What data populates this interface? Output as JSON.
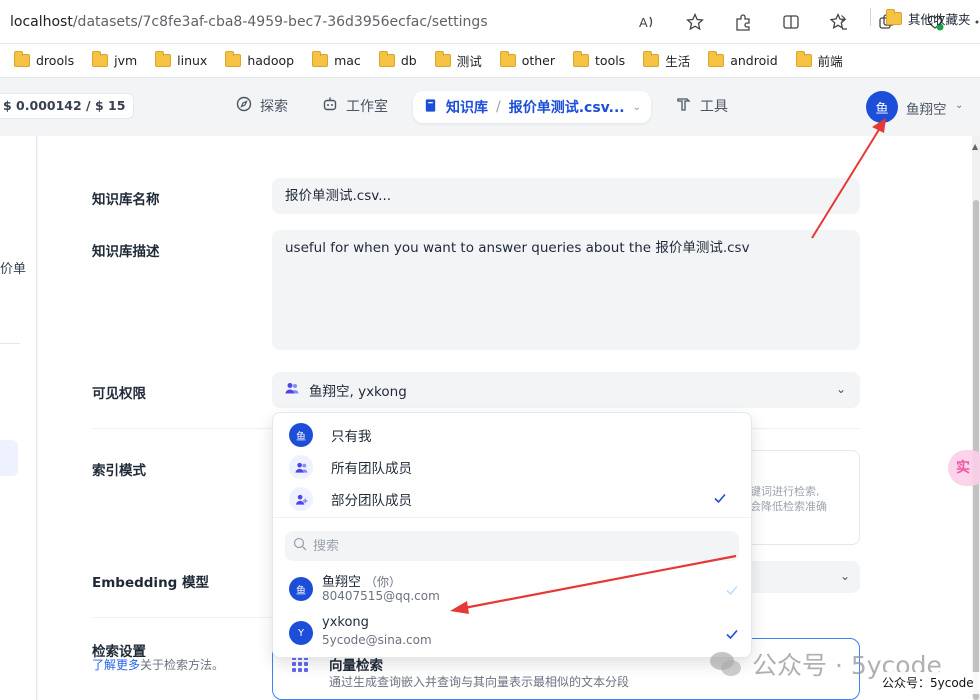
{
  "browser": {
    "url_host": "localhost",
    "url_path": "/datasets/7c8fe3af-cba8-4959-bec7-36d3956ecfac/settings",
    "icons": [
      "read-aloud-icon",
      "favorite-star-icon",
      "extensions-icon",
      "split-screen-icon",
      "favorites-icon",
      "collections-icon",
      "performance-icon",
      "more-icon"
    ],
    "notification_count": "1"
  },
  "bookmarks": {
    "items": [
      "drools",
      "jvm",
      "linux",
      "hadoop",
      "mac",
      "db",
      "测试",
      "other",
      "tools",
      "生活",
      "android",
      "前端"
    ],
    "more": "›",
    "other_favorites": "其他收藏夹"
  },
  "nav": {
    "cost": "$ 0.000142 / $ 15",
    "explore": "探索",
    "studio": "工作室",
    "knowledge": "知识库",
    "crumb_sep": "/",
    "dataset_name": "报价单测试.csv...",
    "tools": "工具",
    "avatar_char": "鱼",
    "username": "鱼翔空"
  },
  "sidebar": {
    "partial_text": "价单"
  },
  "form": {
    "name_label": "知识库名称",
    "name_value": "报价单测试.csv...",
    "desc_label": "知识库描述",
    "desc_value": "useful for when you want to answer queries about the 报价单测试.csv",
    "perm_label": "可见权限",
    "perm_value": "鱼翔空, yxkong",
    "index_label": "索引模式",
    "index_partial_1": "键词进行检索,",
    "index_partial_2": "会降低检索准确",
    "embedding_label": "Embedding 模型",
    "retrieval_label": "检索设置",
    "retrieval_link": "了解更多",
    "retrieval_help": "关于检索方法。",
    "vector_title": "向量检索",
    "vector_desc": "通过生成查询嵌入并查询与其向量表示最相似的文本分段"
  },
  "dropdown": {
    "options": [
      {
        "label": "只有我",
        "selected": false
      },
      {
        "label": "所有团队成员",
        "selected": false
      },
      {
        "label": "部分团队成员",
        "selected": true
      }
    ],
    "search_placeholder": "搜索",
    "members": [
      {
        "avatar": "鱼",
        "name": "鱼翔空",
        "you_tag": "（你）",
        "email": "80407515@qq.com",
        "selected": true,
        "locked": true
      },
      {
        "avatar": "Y",
        "name": "yxkong",
        "you_tag": "",
        "email": "5ycode@sina.com",
        "selected": true,
        "locked": false
      }
    ]
  },
  "floating_button": "实",
  "watermark": {
    "text": "公众号 · 5ycode",
    "caption": "公众号：5ycode"
  },
  "colors": {
    "accent": "#1d4ed8",
    "arrow": "#e53935",
    "check_active": "#1d4ed8",
    "check_disabled": "#bfdbfe"
  }
}
